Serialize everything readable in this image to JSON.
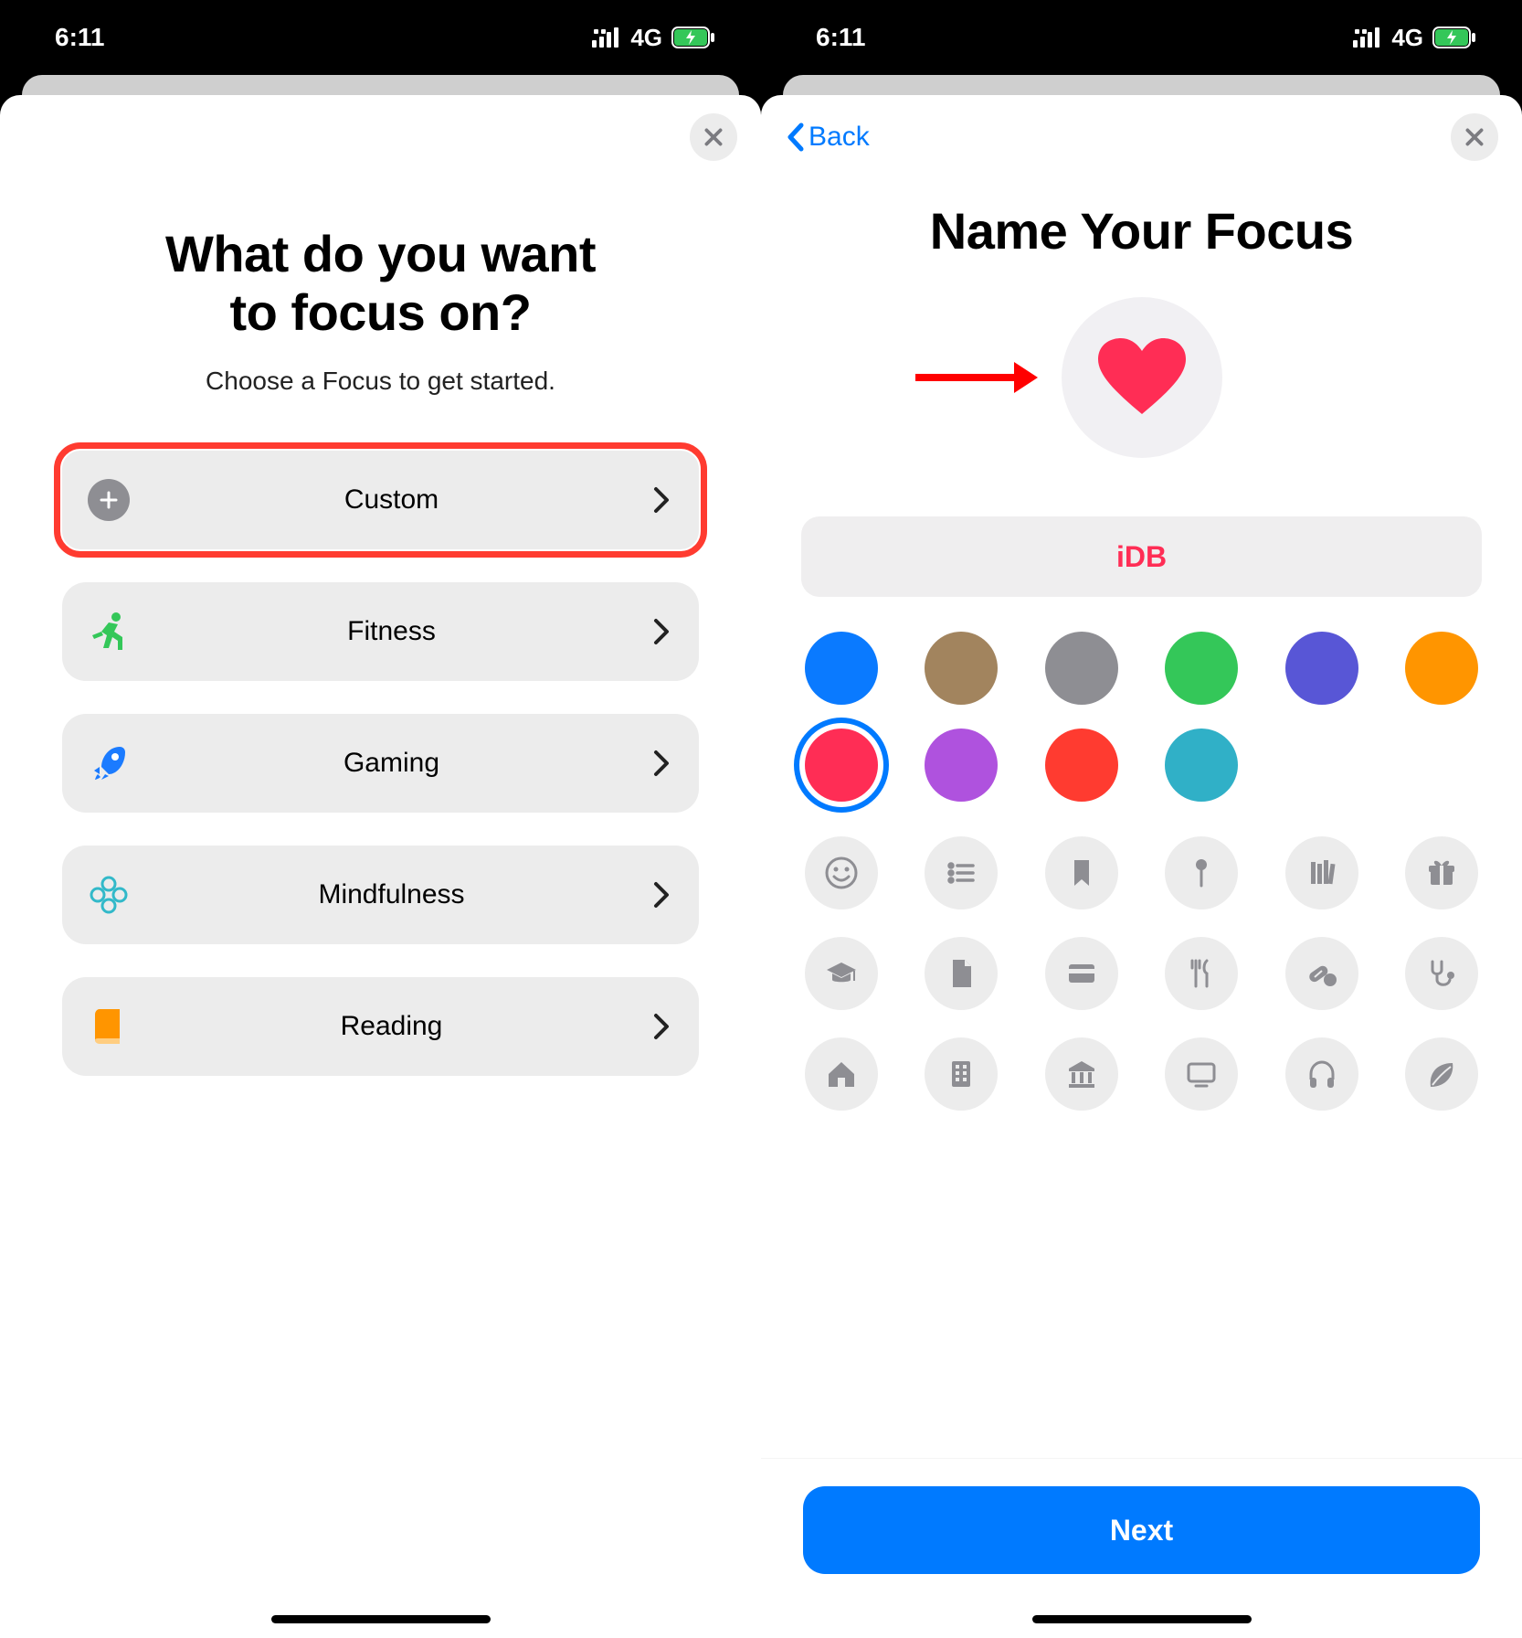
{
  "status": {
    "time": "6:11",
    "network": "4G"
  },
  "screen1": {
    "title_line1": "What do you want",
    "title_line2": "to focus on?",
    "subtitle": "Choose a Focus to get started.",
    "items": [
      {
        "id": "custom",
        "label": "Custom",
        "icon": "plus-circle-icon",
        "color": "#8e8e93",
        "highlight": true
      },
      {
        "id": "fitness",
        "label": "Fitness",
        "icon": "running-icon",
        "color": "#34c759"
      },
      {
        "id": "gaming",
        "label": "Gaming",
        "icon": "rocket-icon",
        "color": "#1b7bff"
      },
      {
        "id": "mindfulness",
        "label": "Mindfulness",
        "icon": "flower-icon",
        "color": "#32b9c9"
      },
      {
        "id": "reading",
        "label": "Reading",
        "icon": "book-icon",
        "color": "#ff9500"
      }
    ]
  },
  "screen2": {
    "back_label": "Back",
    "title": "Name Your Focus",
    "name_value": "iDB",
    "next_label": "Next",
    "preview_icon": "heart-icon",
    "preview_color": "#ff2d55",
    "colors": [
      {
        "hex": "#0a7aff"
      },
      {
        "hex": "#a2845e"
      },
      {
        "hex": "#8e8e93"
      },
      {
        "hex": "#34c759"
      },
      {
        "hex": "#5856d6"
      },
      {
        "hex": "#ff9500"
      },
      {
        "hex": "#ff2d55",
        "selected": true
      },
      {
        "hex": "#af52de"
      },
      {
        "hex": "#ff3b30"
      },
      {
        "hex": "#30b0c7"
      }
    ],
    "glyphs": [
      "smile-icon",
      "list-icon",
      "bookmark-icon",
      "pin-icon",
      "books-icon",
      "gift-icon",
      "grad-cap-icon",
      "document-icon",
      "card-icon",
      "fork-knife-icon",
      "pills-icon",
      "stethoscope-icon",
      "house-icon",
      "building-icon",
      "bank-icon",
      "display-icon",
      "headphones-icon",
      "leaf-icon"
    ]
  }
}
